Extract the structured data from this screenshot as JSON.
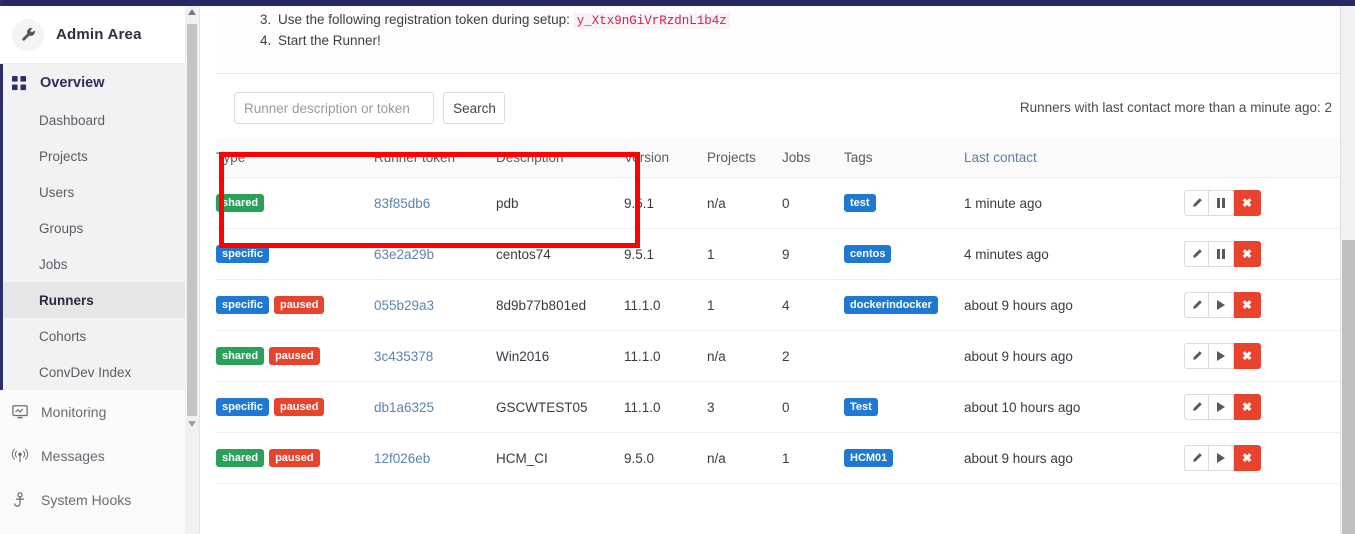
{
  "sidebar": {
    "header": {
      "title": "Admin Area",
      "icon": "wrench-icon"
    },
    "overview": {
      "label": "Overview",
      "icon": "grid-icon"
    },
    "sub_items": [
      {
        "label": "Dashboard",
        "active": false
      },
      {
        "label": "Projects",
        "active": false
      },
      {
        "label": "Users",
        "active": false
      },
      {
        "label": "Groups",
        "active": false
      },
      {
        "label": "Jobs",
        "active": false
      },
      {
        "label": "Runners",
        "active": true
      },
      {
        "label": "Cohorts",
        "active": false
      },
      {
        "label": "ConvDev Index",
        "active": false
      }
    ],
    "items": [
      {
        "label": "Monitoring",
        "icon": "monitor-icon"
      },
      {
        "label": "Messages",
        "icon": "broadcast-icon"
      },
      {
        "label": "System Hooks",
        "icon": "hook-icon"
      }
    ]
  },
  "instructions": {
    "step3_num": "3.",
    "step3_text": "Use the following registration token during setup:",
    "registration_token": "y_Xtx9nGiVrRzdnL1b4z",
    "step4_num": "4.",
    "step4_text": "Start the Runner!"
  },
  "search": {
    "placeholder": "Runner description or token",
    "value": "",
    "button_label": "Search"
  },
  "stale_note": "Runners with last contact more than a minute ago: 2",
  "table": {
    "headers": {
      "type": "Type",
      "token": "Runner token",
      "description": "Description",
      "version": "Version",
      "projects": "Projects",
      "jobs": "Jobs",
      "tags": "Tags",
      "last_contact": "Last contact"
    },
    "rows": [
      {
        "type_badges": [
          "shared"
        ],
        "token": "83f85db6",
        "description": "pdb",
        "version": "9.5.1",
        "projects": "n/a",
        "jobs": "0",
        "tags": [
          "test"
        ],
        "last_contact": "1 minute ago",
        "toggle_icon": "pause-icon"
      },
      {
        "type_badges": [
          "specific"
        ],
        "token": "63e2a29b",
        "description": "centos74",
        "version": "9.5.1",
        "projects": "1",
        "jobs": "9",
        "tags": [
          "centos"
        ],
        "last_contact": "4 minutes ago",
        "toggle_icon": "pause-icon"
      },
      {
        "type_badges": [
          "specific",
          "paused"
        ],
        "token": "055b29a3",
        "description": "8d9b77b801ed",
        "version": "11.1.0",
        "projects": "1",
        "jobs": "4",
        "tags": [
          "dockerindocker"
        ],
        "last_contact": "about 9 hours ago",
        "toggle_icon": "play-icon"
      },
      {
        "type_badges": [
          "shared",
          "paused"
        ],
        "token": "3c435378",
        "description": "Win2016",
        "version": "11.1.0",
        "projects": "n/a",
        "jobs": "2",
        "tags": [],
        "last_contact": "about 9 hours ago",
        "toggle_icon": "play-icon"
      },
      {
        "type_badges": [
          "specific",
          "paused"
        ],
        "token": "db1a6325",
        "description": "GSCWTEST05",
        "version": "11.1.0",
        "projects": "3",
        "jobs": "0",
        "tags": [
          "Test"
        ],
        "last_contact": "about 10 hours ago",
        "toggle_icon": "play-icon"
      },
      {
        "type_badges": [
          "shared",
          "paused"
        ],
        "token": "12f026eb",
        "description": "HCM_CI",
        "version": "9.5.0",
        "projects": "n/a",
        "jobs": "1",
        "tags": [
          "HCM01"
        ],
        "last_contact": "about 9 hours ago",
        "toggle_icon": "play-icon"
      }
    ],
    "badge_labels": {
      "shared": "shared",
      "specific": "specific",
      "paused": "paused"
    },
    "action_labels": {
      "edit": "edit-icon",
      "delete": "✖"
    }
  },
  "colors": {
    "shared_badge": "#2aa05a",
    "specific_badge": "#1f78d1",
    "paused_badge": "#e8432c",
    "tag_badge": "#1f78d1",
    "delete_button": "#e8432c",
    "annotation": "#fe0000",
    "link": "#5b84b1",
    "topbar": "#292961"
  }
}
